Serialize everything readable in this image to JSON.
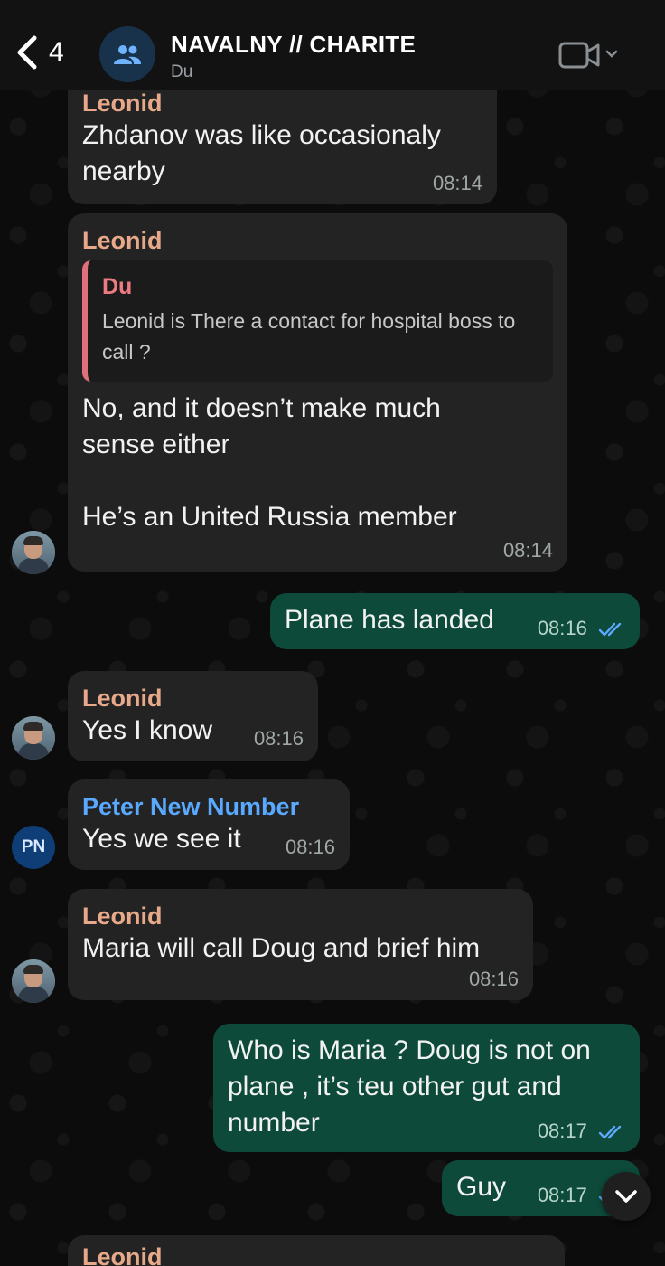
{
  "header": {
    "back_count": "4",
    "title": "NAVALNY // CHARITE",
    "subtitle": "Du"
  },
  "messages": [
    {
      "sender": "Leonid",
      "text": "Zhdanov was like occasionaly\nnearby",
      "time": "08:14",
      "direction": "incoming"
    },
    {
      "sender": "Leonid",
      "quote": {
        "sender": "Du",
        "text": "Leonid is There a contact for hospital boss to call ?"
      },
      "text": "No, and it doesn’t make much\nsense either\n\nHe’s an United Russia member",
      "time": "08:14",
      "direction": "incoming"
    },
    {
      "text": "Plane has landed",
      "time": "08:16",
      "direction": "outgoing"
    },
    {
      "sender": "Leonid",
      "text": "Yes I know",
      "time": "08:16",
      "direction": "incoming"
    },
    {
      "sender": "Peter New Number",
      "avatar_initials": "PN",
      "text": "Yes we see it",
      "time": "08:16",
      "direction": "incoming"
    },
    {
      "sender": "Leonid",
      "text": "Maria will call Doug and brief him",
      "time": "08:16",
      "direction": "incoming"
    },
    {
      "text": "Who is Maria ? Doug is not on\nplane , it’s teu other gut and\nnumber",
      "time": "08:17",
      "direction": "outgoing"
    },
    {
      "text": "Guy",
      "time": "08:17",
      "direction": "outgoing"
    },
    {
      "sender": "Leonid",
      "direction": "incoming",
      "partial": true
    }
  ],
  "colors": {
    "incoming_bubble": "#232323",
    "outgoing_bubble": "#0d4a3a",
    "leonid_name": "#e7a98a",
    "peter_name": "#58a9ff",
    "quote_accent": "#e0707a",
    "read_ticks": "#5ea8ff"
  },
  "icons": {
    "back": "chevron-left-icon",
    "group": "group-people-icon",
    "video": "video-camera-icon",
    "read": "double-check-icon",
    "scroll": "chevron-down-icon"
  }
}
